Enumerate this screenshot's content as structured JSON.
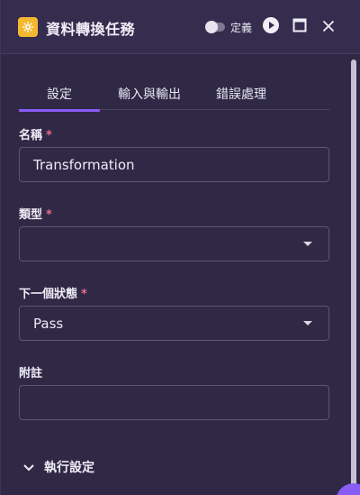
{
  "header": {
    "title": "資料轉換任務",
    "toggle_label": "定義",
    "toggle_on": false
  },
  "tabs": [
    {
      "label": "設定",
      "active": true
    },
    {
      "label": "輸入與輸出",
      "active": false
    },
    {
      "label": "錯誤處理",
      "active": false
    }
  ],
  "form": {
    "name": {
      "label": "名稱",
      "required_mark": "*",
      "value": "Transformation"
    },
    "type": {
      "label": "類型",
      "required_mark": "*",
      "value": ""
    },
    "next_state": {
      "label": "下一個狀態",
      "required_mark": "*",
      "value": "Pass"
    },
    "note": {
      "label": "附註",
      "value": ""
    }
  },
  "sections": {
    "execution": {
      "label": "執行設定",
      "expanded": false
    }
  },
  "colors": {
    "accent": "#8a5cf6",
    "required": "#ef6b8a",
    "app_icon": "#f3b830",
    "background": "#2f2946"
  },
  "icons": {
    "app": "cog-icon",
    "run": "play-circle-icon",
    "maximize": "maximize-icon",
    "close": "close-icon",
    "dropdown": "caret-down-icon",
    "section": "chevron-down-icon"
  }
}
